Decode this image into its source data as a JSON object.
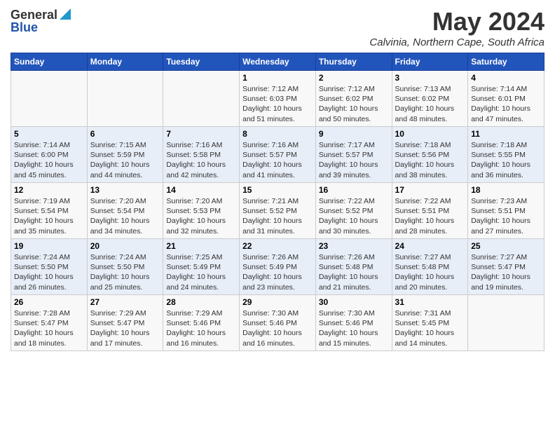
{
  "logo": {
    "general": "General",
    "blue": "Blue"
  },
  "title": "May 2024",
  "subtitle": "Calvinia, Northern Cape, South Africa",
  "weekdays": [
    "Sunday",
    "Monday",
    "Tuesday",
    "Wednesday",
    "Thursday",
    "Friday",
    "Saturday"
  ],
  "weeks": [
    [
      {
        "day": "",
        "detail": ""
      },
      {
        "day": "",
        "detail": ""
      },
      {
        "day": "",
        "detail": ""
      },
      {
        "day": "1",
        "detail": "Sunrise: 7:12 AM\nSunset: 6:03 PM\nDaylight: 10 hours\nand 51 minutes."
      },
      {
        "day": "2",
        "detail": "Sunrise: 7:12 AM\nSunset: 6:02 PM\nDaylight: 10 hours\nand 50 minutes."
      },
      {
        "day": "3",
        "detail": "Sunrise: 7:13 AM\nSunset: 6:02 PM\nDaylight: 10 hours\nand 48 minutes."
      },
      {
        "day": "4",
        "detail": "Sunrise: 7:14 AM\nSunset: 6:01 PM\nDaylight: 10 hours\nand 47 minutes."
      }
    ],
    [
      {
        "day": "5",
        "detail": "Sunrise: 7:14 AM\nSunset: 6:00 PM\nDaylight: 10 hours\nand 45 minutes."
      },
      {
        "day": "6",
        "detail": "Sunrise: 7:15 AM\nSunset: 5:59 PM\nDaylight: 10 hours\nand 44 minutes."
      },
      {
        "day": "7",
        "detail": "Sunrise: 7:16 AM\nSunset: 5:58 PM\nDaylight: 10 hours\nand 42 minutes."
      },
      {
        "day": "8",
        "detail": "Sunrise: 7:16 AM\nSunset: 5:57 PM\nDaylight: 10 hours\nand 41 minutes."
      },
      {
        "day": "9",
        "detail": "Sunrise: 7:17 AM\nSunset: 5:57 PM\nDaylight: 10 hours\nand 39 minutes."
      },
      {
        "day": "10",
        "detail": "Sunrise: 7:18 AM\nSunset: 5:56 PM\nDaylight: 10 hours\nand 38 minutes."
      },
      {
        "day": "11",
        "detail": "Sunrise: 7:18 AM\nSunset: 5:55 PM\nDaylight: 10 hours\nand 36 minutes."
      }
    ],
    [
      {
        "day": "12",
        "detail": "Sunrise: 7:19 AM\nSunset: 5:54 PM\nDaylight: 10 hours\nand 35 minutes."
      },
      {
        "day": "13",
        "detail": "Sunrise: 7:20 AM\nSunset: 5:54 PM\nDaylight: 10 hours\nand 34 minutes."
      },
      {
        "day": "14",
        "detail": "Sunrise: 7:20 AM\nSunset: 5:53 PM\nDaylight: 10 hours\nand 32 minutes."
      },
      {
        "day": "15",
        "detail": "Sunrise: 7:21 AM\nSunset: 5:52 PM\nDaylight: 10 hours\nand 31 minutes."
      },
      {
        "day": "16",
        "detail": "Sunrise: 7:22 AM\nSunset: 5:52 PM\nDaylight: 10 hours\nand 30 minutes."
      },
      {
        "day": "17",
        "detail": "Sunrise: 7:22 AM\nSunset: 5:51 PM\nDaylight: 10 hours\nand 28 minutes."
      },
      {
        "day": "18",
        "detail": "Sunrise: 7:23 AM\nSunset: 5:51 PM\nDaylight: 10 hours\nand 27 minutes."
      }
    ],
    [
      {
        "day": "19",
        "detail": "Sunrise: 7:24 AM\nSunset: 5:50 PM\nDaylight: 10 hours\nand 26 minutes."
      },
      {
        "day": "20",
        "detail": "Sunrise: 7:24 AM\nSunset: 5:50 PM\nDaylight: 10 hours\nand 25 minutes."
      },
      {
        "day": "21",
        "detail": "Sunrise: 7:25 AM\nSunset: 5:49 PM\nDaylight: 10 hours\nand 24 minutes."
      },
      {
        "day": "22",
        "detail": "Sunrise: 7:26 AM\nSunset: 5:49 PM\nDaylight: 10 hours\nand 23 minutes."
      },
      {
        "day": "23",
        "detail": "Sunrise: 7:26 AM\nSunset: 5:48 PM\nDaylight: 10 hours\nand 21 minutes."
      },
      {
        "day": "24",
        "detail": "Sunrise: 7:27 AM\nSunset: 5:48 PM\nDaylight: 10 hours\nand 20 minutes."
      },
      {
        "day": "25",
        "detail": "Sunrise: 7:27 AM\nSunset: 5:47 PM\nDaylight: 10 hours\nand 19 minutes."
      }
    ],
    [
      {
        "day": "26",
        "detail": "Sunrise: 7:28 AM\nSunset: 5:47 PM\nDaylight: 10 hours\nand 18 minutes."
      },
      {
        "day": "27",
        "detail": "Sunrise: 7:29 AM\nSunset: 5:47 PM\nDaylight: 10 hours\nand 17 minutes."
      },
      {
        "day": "28",
        "detail": "Sunrise: 7:29 AM\nSunset: 5:46 PM\nDaylight: 10 hours\nand 16 minutes."
      },
      {
        "day": "29",
        "detail": "Sunrise: 7:30 AM\nSunset: 5:46 PM\nDaylight: 10 hours\nand 16 minutes."
      },
      {
        "day": "30",
        "detail": "Sunrise: 7:30 AM\nSunset: 5:46 PM\nDaylight: 10 hours\nand 15 minutes."
      },
      {
        "day": "31",
        "detail": "Sunrise: 7:31 AM\nSunset: 5:45 PM\nDaylight: 10 hours\nand 14 minutes."
      },
      {
        "day": "",
        "detail": ""
      }
    ]
  ]
}
